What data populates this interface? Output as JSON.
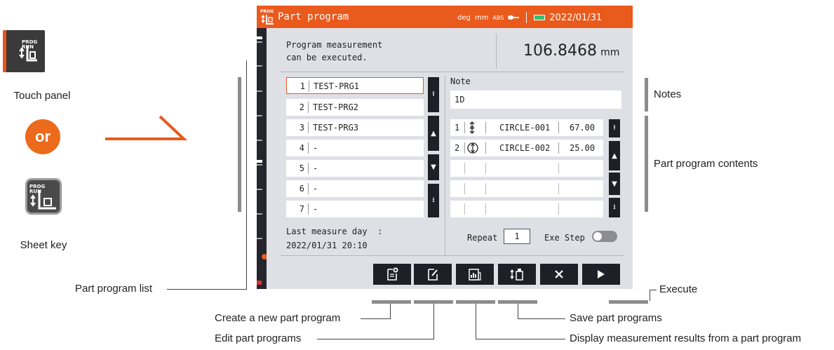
{
  "left": {
    "touch_panel_label": "Touch panel",
    "or_label": "or",
    "sheet_key_label": "Sheet key",
    "key_text": [
      "PROG",
      "RUN"
    ]
  },
  "screen": {
    "title": "Part program",
    "prog_badge": "PROG",
    "status": {
      "unit_angle": "deg",
      "unit_length": "mm",
      "mode": "ABS",
      "date": "2022/01/31"
    },
    "message_line1": "Program measurement",
    "message_line2": "can be executed.",
    "measure_value": "106.8468",
    "measure_unit": "mm",
    "program_list": [
      {
        "num": "1",
        "name": "TEST-PRG1",
        "selected": true
      },
      {
        "num": "2",
        "name": "TEST-PRG2"
      },
      {
        "num": "3",
        "name": "TEST-PRG3"
      },
      {
        "num": "4",
        "name": "-"
      },
      {
        "num": "5",
        "name": "-"
      },
      {
        "num": "6",
        "name": "-"
      },
      {
        "num": "7",
        "name": "-"
      }
    ],
    "last_measure_label": "Last measure day  :",
    "last_measure_value": "2022/01/31 20:10",
    "note_label": "Note",
    "note_value": "1D",
    "contents": [
      {
        "num": "1",
        "icon": "axial-runout-icon",
        "element": "CIRCLE-001",
        "value": "67.00"
      },
      {
        "num": "2",
        "icon": "circular-runout-icon",
        "element": "CIRCLE-002",
        "value": "25.00"
      },
      {
        "num": "",
        "icon": "",
        "element": "",
        "value": ""
      },
      {
        "num": "",
        "icon": "",
        "element": "",
        "value": ""
      },
      {
        "num": "",
        "icon": "",
        "element": "",
        "value": ""
      }
    ],
    "repeat_label": "Repeat",
    "repeat_value": "1",
    "exe_step_label": "Exe Step"
  },
  "annotations": {
    "notes": "Notes",
    "contents": "Part program contents",
    "list": "Part program list",
    "execute": "Execute",
    "create": "Create a new part program",
    "edit": "Edit part programs",
    "save": "Save part programs",
    "display": "Display measurement results from a part program"
  },
  "colors": {
    "accent": "#ea5a1c",
    "button": "#1f1f28",
    "screen_bg": "#dfe0e6",
    "callout_bar": "#8c8c8c"
  }
}
